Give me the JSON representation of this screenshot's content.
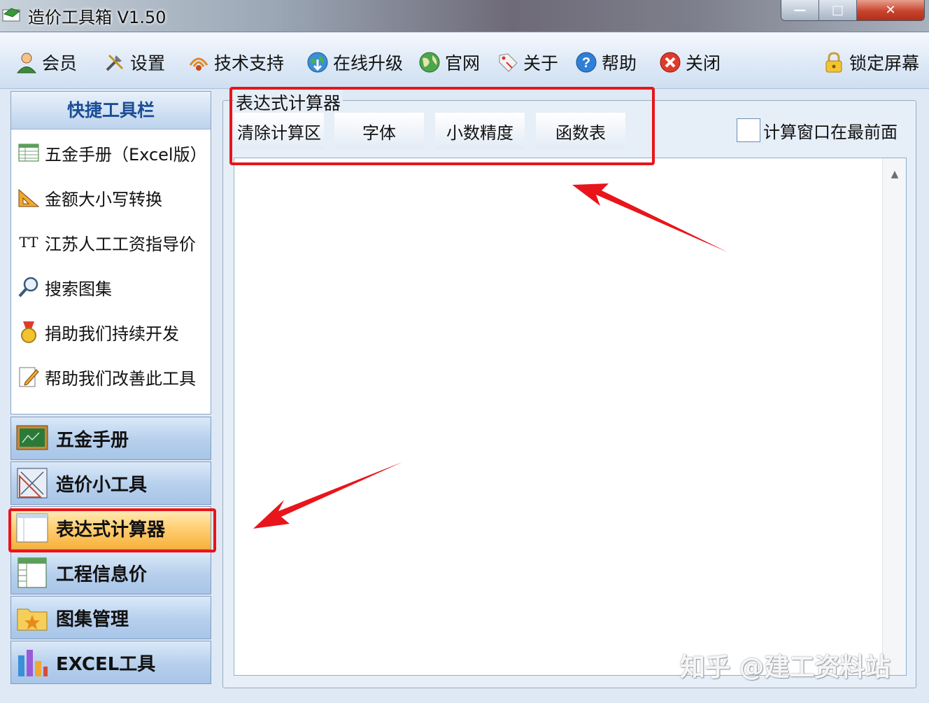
{
  "window": {
    "title": "造价工具箱 V1.50",
    "controls": {
      "minimize": "—",
      "maximize": "□",
      "close": "✕"
    }
  },
  "toolbar": {
    "items": [
      {
        "label": "会员",
        "icon": "user-icon"
      },
      {
        "label": "设置",
        "icon": "tools-icon"
      },
      {
        "label": "技术支持",
        "icon": "support-icon"
      },
      {
        "label": "在线升级",
        "icon": "update-globe-icon"
      },
      {
        "label": "官网",
        "icon": "globe-icon"
      },
      {
        "label": "关于",
        "icon": "tag-icon"
      },
      {
        "label": "帮助",
        "icon": "help-icon"
      },
      {
        "label": "关闭",
        "icon": "close-icon"
      }
    ],
    "lock": {
      "label": "锁定屏幕",
      "icon": "lock-icon"
    }
  },
  "quickbar": {
    "title": "快捷工具栏",
    "items": [
      {
        "label": "五金手册（Excel版）",
        "icon": "spreadsheet-icon"
      },
      {
        "label": "金额大小写转换",
        "icon": "ruler-triangle-icon"
      },
      {
        "label": "江苏人工工资指导价",
        "icon": "font-tt-icon",
        "icon_text": "TT"
      },
      {
        "label": "搜索图集",
        "icon": "magnifier-icon"
      },
      {
        "label": "捐助我们持续开发",
        "icon": "medal-icon"
      },
      {
        "label": "帮助我们改善此工具",
        "icon": "edit-note-icon"
      }
    ]
  },
  "nav": {
    "items": [
      {
        "label": "五金手册",
        "icon": "blackboard-icon",
        "active": false
      },
      {
        "label": "造价小工具",
        "icon": "drafting-icon",
        "active": false
      },
      {
        "label": "表达式计算器",
        "icon": "window-icon",
        "active": true
      },
      {
        "label": "工程信息价",
        "icon": "table-icon",
        "active": false
      },
      {
        "label": "图集管理",
        "icon": "star-folder-icon",
        "active": false
      },
      {
        "label": "EXCEL工具",
        "icon": "bar-chart-icon",
        "active": false
      }
    ]
  },
  "calculator": {
    "group_title": "表达式计算器",
    "buttons": [
      "清除计算区",
      "字体",
      "小数精度",
      "函数表"
    ],
    "topmost_label": "计算窗口在最前面",
    "topmost_checked": false,
    "expression": ""
  },
  "watermark": "知乎 @建工资料站",
  "colors": {
    "highlight": "#e8151b",
    "active_nav": "#f8b13a",
    "accent": "#1b4d96"
  }
}
